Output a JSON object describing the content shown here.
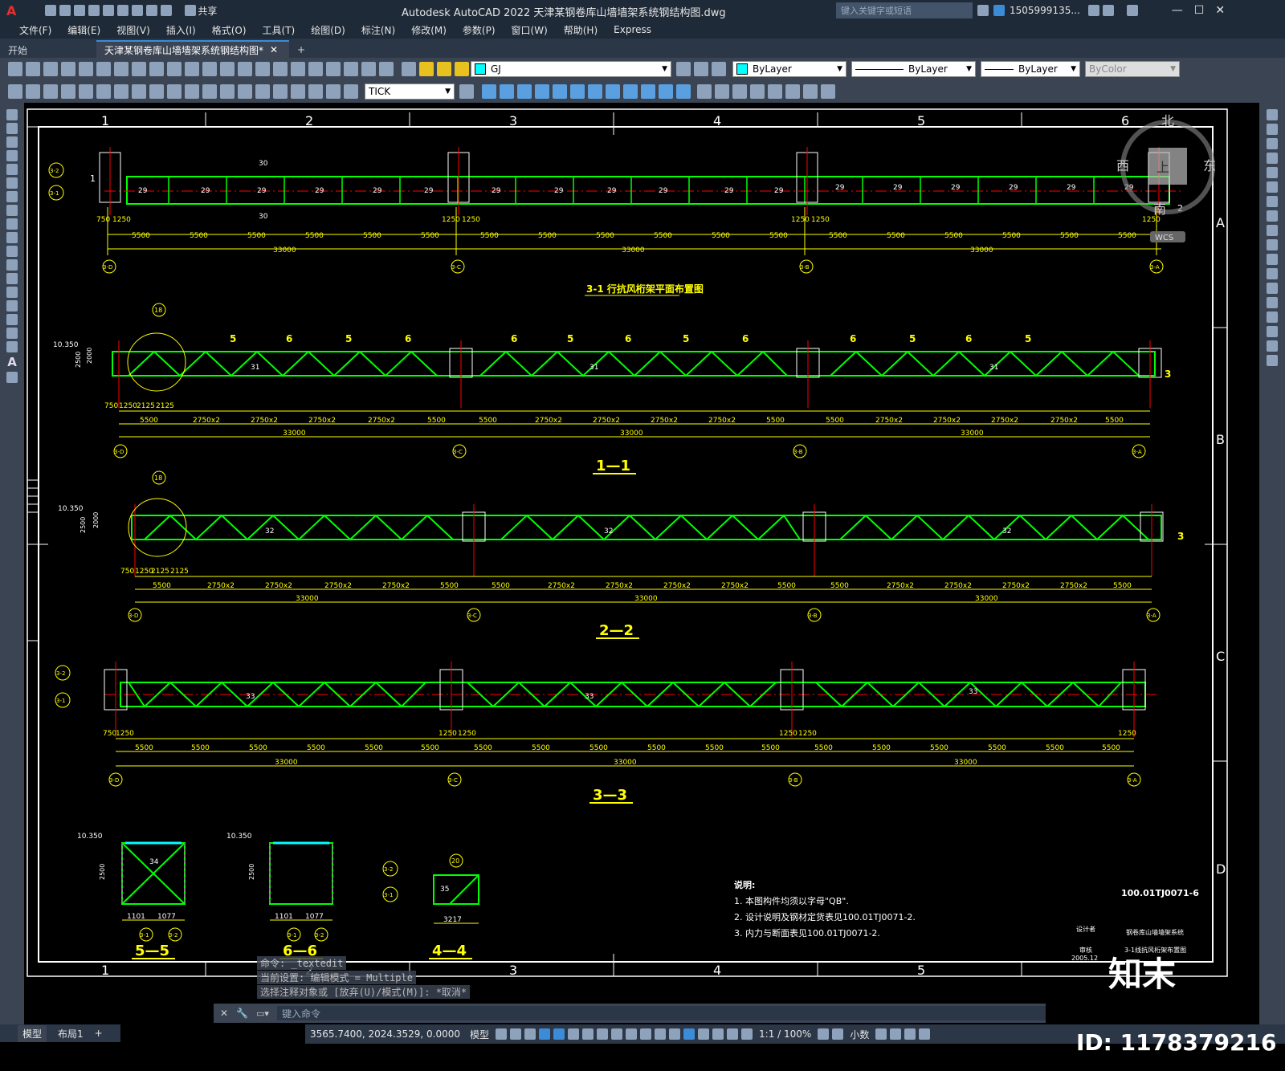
{
  "app": {
    "title": "Autodesk AutoCAD 2022    天津某钢卷库山墙墙架系统钢结构图.dwg",
    "share_label": "共享",
    "search_placeholder": "键入关键字或短语",
    "user": "1505999135...",
    "logo": "A"
  },
  "menu": [
    "文件(F)",
    "编辑(E)",
    "视图(V)",
    "插入(I)",
    "格式(O)",
    "工具(T)",
    "绘图(D)",
    "标注(N)",
    "修改(M)",
    "参数(P)",
    "窗口(W)",
    "帮助(H)",
    "Express"
  ],
  "tabs": {
    "start": "开始",
    "doc": "天津某钢卷库山墙墙架系统钢结构图*",
    "add": "+"
  },
  "toolbar": {
    "layer": "GJ",
    "color": "ByLayer",
    "linetype": "ByLayer",
    "lineweight": "ByLayer",
    "plotstyle": "ByColor",
    "dimstyle": "TICK"
  },
  "drawing": {
    "top_grid": [
      "1",
      "2",
      "3",
      "4",
      "5",
      "6"
    ],
    "bottom_grid": [
      "1",
      "2",
      "3",
      "4",
      "5"
    ],
    "side_rows": [
      "A",
      "B",
      "C",
      "D"
    ],
    "plan_title": "3-1 行抗风桁架平面布置图",
    "section_1": "1—1",
    "section_2": "2—2",
    "section_3": "3—3",
    "section_4": "4—4",
    "section_5": "5—5",
    "section_6": "6—6",
    "axis_labels": [
      "3-D",
      "3-C",
      "3-B",
      "3-A"
    ],
    "span_total": "33000",
    "span_5500": "5500",
    "span_2750": "2750x2",
    "elev": "10.350",
    "height_2500": "2500",
    "height_2000": "2000",
    "dim_1250": "1250",
    "dim_750": "750",
    "dim_2125": "2125",
    "dim_1101": "1101",
    "dim_1077": "1077",
    "dim_3217": "3217",
    "member_29": "29",
    "member_31": "31",
    "member_32": "32",
    "member_33": "33",
    "member_34": "34",
    "member_35": "35",
    "callout_18": "18",
    "callout_20": "20",
    "callout_30": "30",
    "section_mark_5": "5",
    "section_mark_6": "6",
    "section_mark_3": "3",
    "section_mark_2": "2",
    "section_mark_1": "1",
    "axis_3_1": "3-1",
    "axis_3_2": "3-2",
    "notes_title": "说明:",
    "notes": [
      "1. 本图构件均须以字母\"QB\".",
      "2. 设计说明及钢材定货表见100.01TJ0071-2.",
      "3. 内力与断面表见100.01TJ0071-2."
    ],
    "drawing_no": "100.01TJ0071-6",
    "tb_system": "钢卷库山墙墙架系统",
    "tb_title": "3-1线抗风桁架布置图",
    "tb_date": "2005.12",
    "tb_designer": "设计者",
    "tb_checker": "审核"
  },
  "viewcube": {
    "north": "北",
    "south": "南",
    "east": "东",
    "west": "西",
    "top": "上",
    "wcs": "WCS"
  },
  "command": {
    "history": [
      "命令: _textedit",
      "当前设置: 编辑模式 = Multiple",
      "选择注释对象或 [放弃(U)/模式(M)]: *取消*"
    ],
    "placeholder": "键入命令"
  },
  "status": {
    "coords": "3565.7400, 2024.3529, 0.0000",
    "model": "模型",
    "scale": "1:1 / 100%",
    "units": "小数",
    "layout_model": "模型",
    "layout_1": "布局1",
    "layout_add": "+"
  },
  "watermark": {
    "brand": "知末",
    "id": "ID: 1178379216"
  },
  "colors": {
    "accent": "#3b8bd6",
    "truss": "#00ff00",
    "dim": "#ffff00",
    "axis_red": "#ff0000",
    "magenta": "#ff00ff",
    "cyan": "#00ffff",
    "white": "#ffffff"
  }
}
